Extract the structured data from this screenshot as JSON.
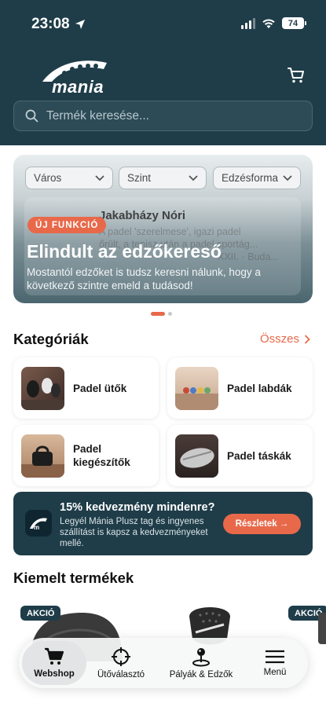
{
  "status_bar": {
    "time": "23:08",
    "battery": "74"
  },
  "header": {
    "logo_text": "mania",
    "search_placeholder": "Termék keresése..."
  },
  "banner": {
    "filters": [
      "Város",
      "Szint",
      "Edzésforma"
    ],
    "background_card": {
      "name": "Jakabházy Nóri",
      "line1": "A padel 'szerelmese', igazi padel",
      "line2": "őrült, a tenisz után a padel sportág...",
      "line3": "XXII. · Buda..."
    },
    "badge": "ÚJ FUNKCIÓ",
    "title": "Elindult az edzőkereső",
    "text": "Mostantól edzőket is tudsz keresni nálunk, hogy a következő szintre emeld a tudásod!"
  },
  "categories": {
    "title": "Kategóriák",
    "see_all": "Összes",
    "items": [
      {
        "label": "Padel ütők"
      },
      {
        "label": "Padel labdák"
      },
      {
        "label": "Padel kiegészítők"
      },
      {
        "label": "Padel táskák"
      }
    ]
  },
  "promo": {
    "title": "15% kedvezmény mindenre?",
    "text": "Legyél Mánia Plusz tag és ingyenes szállítást is kapsz a kedvezményeket mellé.",
    "button": "Részletek →"
  },
  "featured": {
    "title": "Kiemelt termékek",
    "badge_left": "AKCIÓ",
    "badge_right": "AKCIÓ"
  },
  "bottom_nav": {
    "items": [
      "Webshop",
      "Ütőválasztó",
      "Pályák & Edzők",
      "Menü"
    ],
    "active": "Webshop"
  },
  "colors": {
    "header": "#1f3d49",
    "accent": "#e8694a"
  }
}
